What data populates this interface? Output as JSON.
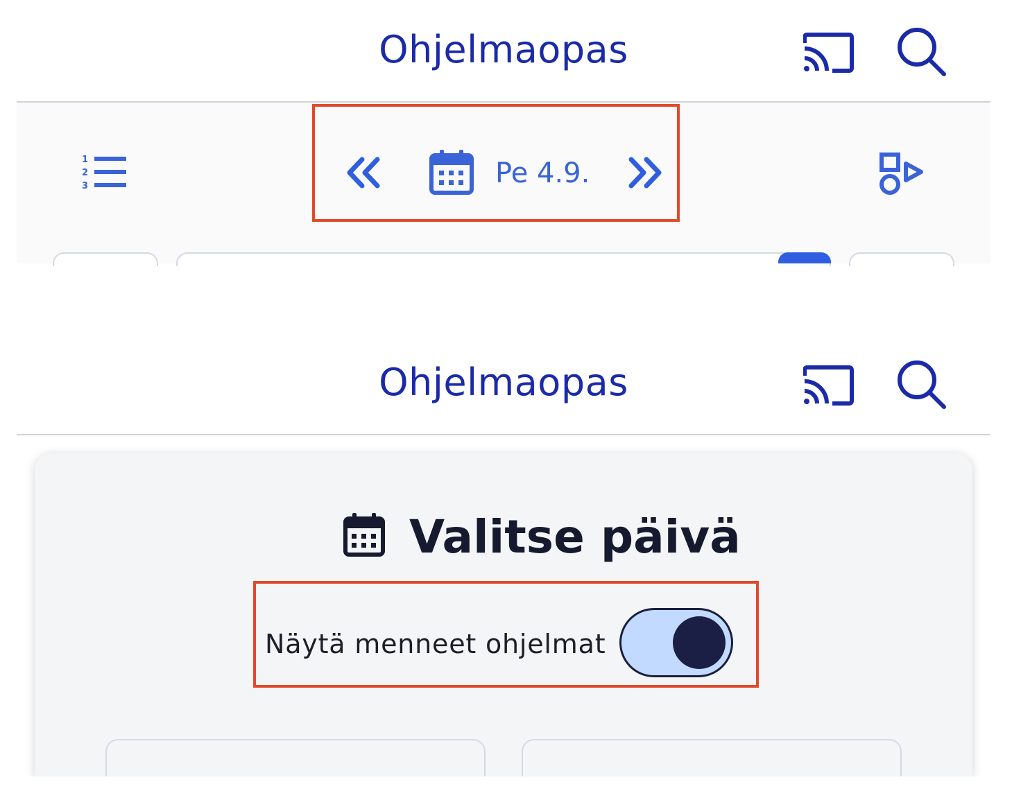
{
  "top_panel": {
    "header": {
      "title": "Ohjelmaopas"
    },
    "date_nav": {
      "date_label": "Pe 4.9."
    }
  },
  "bottom_panel": {
    "header": {
      "title": "Ohjelmaopas"
    },
    "dialog": {
      "title": "Valitse päivä",
      "toggle_label": "Näytä menneet ohjelmat",
      "toggle_on": true
    }
  },
  "colors": {
    "brand_blue": "#1a2aa8",
    "accent_blue": "#3a63d8",
    "highlight": "#e24a2c",
    "toggle_track": "#c2daff",
    "toggle_knob": "#1b1f45"
  },
  "icons": {
    "cast": "cast-icon",
    "search": "search-icon",
    "numbered_list": "numbered-list-icon",
    "prev": "chevron-double-left-icon",
    "next": "chevron-double-right-icon",
    "calendar": "calendar-icon",
    "shapes": "shapes-icon"
  }
}
